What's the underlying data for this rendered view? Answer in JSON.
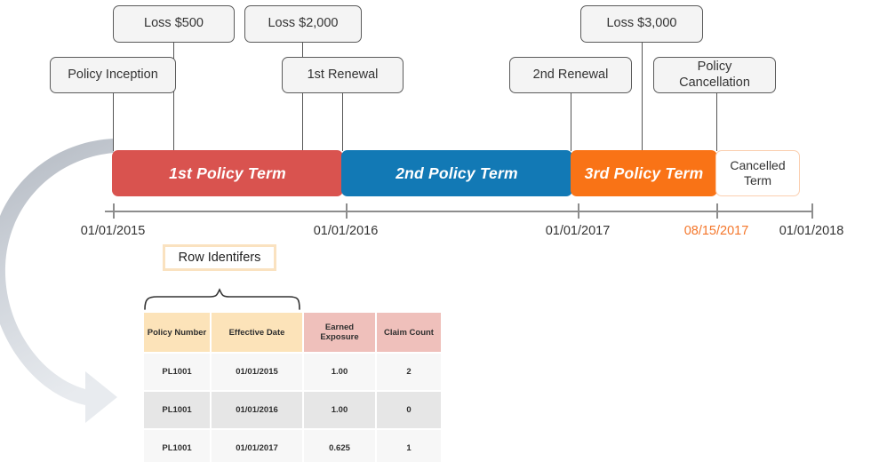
{
  "events": [
    {
      "id": "loss-500",
      "label": "Loss $500"
    },
    {
      "id": "loss-2000",
      "label": "Loss $2,000"
    },
    {
      "id": "loss-3000",
      "label": "Loss $3,000"
    },
    {
      "id": "policy-inception",
      "label": "Policy Inception"
    },
    {
      "id": "first-renewal",
      "label": "1st Renewal"
    },
    {
      "id": "second-renewal",
      "label": "2nd Renewal"
    },
    {
      "id": "policy-cancellation",
      "label": "Policy\nCancellation"
    }
  ],
  "event_labels": {
    "loss_500": "Loss $500",
    "loss_2000": "Loss $2,000",
    "loss_3000": "Loss $3,000",
    "policy_inception": "Policy Inception",
    "first_renewal": "1st Renewal",
    "second_renewal": "2nd Renewal",
    "policy_cancellation_line1": "Policy",
    "policy_cancellation_line2": "Cancellation"
  },
  "terms": [
    {
      "id": "term-1",
      "label": "1st Policy Term",
      "color": "#d9534f"
    },
    {
      "id": "term-2",
      "label": "2nd Policy Term",
      "color": "#1279b5"
    },
    {
      "id": "term-3",
      "label": "3rd Policy Term",
      "color": "#f97316"
    },
    {
      "id": "term-cancelled",
      "label_line1": "Cancelled",
      "label_line2": "Term",
      "color": "#ffffff",
      "border": "#fbcfb0"
    }
  ],
  "axis": {
    "ticks": [
      {
        "label": "01/01/2015",
        "accent": false
      },
      {
        "label": "01/01/2016",
        "accent": false
      },
      {
        "label": "01/01/2017",
        "accent": false
      },
      {
        "label": "08/15/2017",
        "accent": true
      },
      {
        "label": "01/01/2018",
        "accent": false
      }
    ],
    "accent_color": "#f4762a"
  },
  "annotation": {
    "row_identifiers": "Row Identifers"
  },
  "table": {
    "headers": [
      {
        "text": "Policy Number",
        "group": "key"
      },
      {
        "text": "Effective Date",
        "group": "key"
      },
      {
        "text": "Earned Exposure",
        "group": "value"
      },
      {
        "text": "Claim Count",
        "group": "value"
      }
    ],
    "rows": [
      [
        "PL1001",
        "01/01/2015",
        "1.00",
        "2"
      ],
      [
        "PL1001",
        "01/01/2016",
        "1.00",
        "0"
      ],
      [
        "PL1001",
        "01/01/2017",
        "0.625",
        "1"
      ]
    ]
  },
  "colors": {
    "term1": "#d9534f",
    "term2": "#1279b5",
    "term3": "#f97316",
    "cancelled_border": "#fbcfb0",
    "accent_orange": "#f4762a",
    "header_key": "#fce3b9",
    "header_value": "#efc0bb",
    "arrow_top": "#b6bcc4",
    "arrow_bottom": "#e6e9ee"
  }
}
